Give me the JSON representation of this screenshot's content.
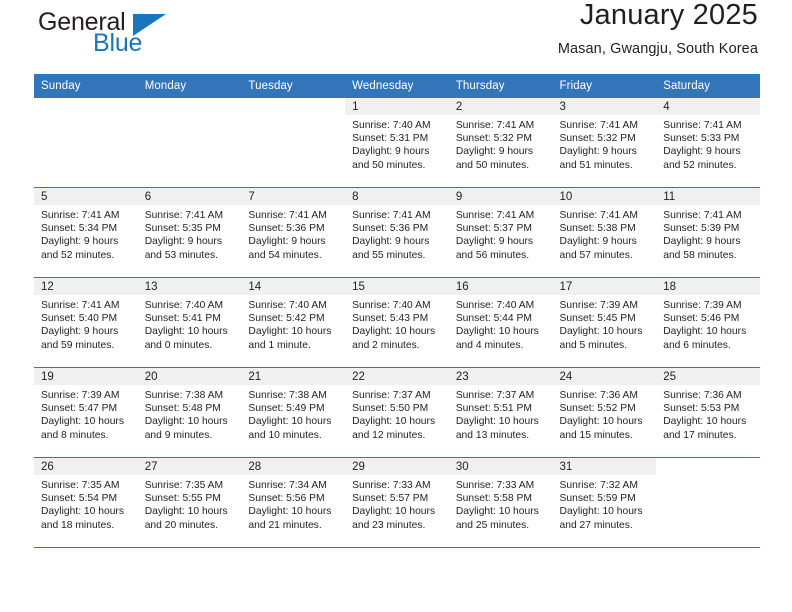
{
  "brand": {
    "name_part1": "General",
    "name_part2": "Blue"
  },
  "header": {
    "title": "January 2025",
    "subtitle": "Masan, Gwangju, South Korea"
  },
  "calendar": {
    "weekday_headers": [
      "Sunday",
      "Monday",
      "Tuesday",
      "Wednesday",
      "Thursday",
      "Friday",
      "Saturday"
    ],
    "colors": {
      "header_blue": "#3275b8",
      "daynum_band": "#f0f0f0",
      "brand_blue": "#1b75bb",
      "text": "#231f20"
    },
    "weeks": [
      [
        {
          "day": "",
          "sunrise": "",
          "sunset": "",
          "daylight_line1": "",
          "daylight_line2": "",
          "blank": true
        },
        {
          "day": "",
          "sunrise": "",
          "sunset": "",
          "daylight_line1": "",
          "daylight_line2": "",
          "blank": true
        },
        {
          "day": "",
          "sunrise": "",
          "sunset": "",
          "daylight_line1": "",
          "daylight_line2": "",
          "blank": true
        },
        {
          "day": "1",
          "sunrise": "Sunrise: 7:40 AM",
          "sunset": "Sunset: 5:31 PM",
          "daylight_line1": "Daylight: 9 hours",
          "daylight_line2": "and 50 minutes."
        },
        {
          "day": "2",
          "sunrise": "Sunrise: 7:41 AM",
          "sunset": "Sunset: 5:32 PM",
          "daylight_line1": "Daylight: 9 hours",
          "daylight_line2": "and 50 minutes."
        },
        {
          "day": "3",
          "sunrise": "Sunrise: 7:41 AM",
          "sunset": "Sunset: 5:32 PM",
          "daylight_line1": "Daylight: 9 hours",
          "daylight_line2": "and 51 minutes."
        },
        {
          "day": "4",
          "sunrise": "Sunrise: 7:41 AM",
          "sunset": "Sunset: 5:33 PM",
          "daylight_line1": "Daylight: 9 hours",
          "daylight_line2": "and 52 minutes."
        }
      ],
      [
        {
          "day": "5",
          "sunrise": "Sunrise: 7:41 AM",
          "sunset": "Sunset: 5:34 PM",
          "daylight_line1": "Daylight: 9 hours",
          "daylight_line2": "and 52 minutes."
        },
        {
          "day": "6",
          "sunrise": "Sunrise: 7:41 AM",
          "sunset": "Sunset: 5:35 PM",
          "daylight_line1": "Daylight: 9 hours",
          "daylight_line2": "and 53 minutes."
        },
        {
          "day": "7",
          "sunrise": "Sunrise: 7:41 AM",
          "sunset": "Sunset: 5:36 PM",
          "daylight_line1": "Daylight: 9 hours",
          "daylight_line2": "and 54 minutes."
        },
        {
          "day": "8",
          "sunrise": "Sunrise: 7:41 AM",
          "sunset": "Sunset: 5:36 PM",
          "daylight_line1": "Daylight: 9 hours",
          "daylight_line2": "and 55 minutes."
        },
        {
          "day": "9",
          "sunrise": "Sunrise: 7:41 AM",
          "sunset": "Sunset: 5:37 PM",
          "daylight_line1": "Daylight: 9 hours",
          "daylight_line2": "and 56 minutes."
        },
        {
          "day": "10",
          "sunrise": "Sunrise: 7:41 AM",
          "sunset": "Sunset: 5:38 PM",
          "daylight_line1": "Daylight: 9 hours",
          "daylight_line2": "and 57 minutes."
        },
        {
          "day": "11",
          "sunrise": "Sunrise: 7:41 AM",
          "sunset": "Sunset: 5:39 PM",
          "daylight_line1": "Daylight: 9 hours",
          "daylight_line2": "and 58 minutes."
        }
      ],
      [
        {
          "day": "12",
          "sunrise": "Sunrise: 7:41 AM",
          "sunset": "Sunset: 5:40 PM",
          "daylight_line1": "Daylight: 9 hours",
          "daylight_line2": "and 59 minutes."
        },
        {
          "day": "13",
          "sunrise": "Sunrise: 7:40 AM",
          "sunset": "Sunset: 5:41 PM",
          "daylight_line1": "Daylight: 10 hours",
          "daylight_line2": "and 0 minutes."
        },
        {
          "day": "14",
          "sunrise": "Sunrise: 7:40 AM",
          "sunset": "Sunset: 5:42 PM",
          "daylight_line1": "Daylight: 10 hours",
          "daylight_line2": "and 1 minute."
        },
        {
          "day": "15",
          "sunrise": "Sunrise: 7:40 AM",
          "sunset": "Sunset: 5:43 PM",
          "daylight_line1": "Daylight: 10 hours",
          "daylight_line2": "and 2 minutes."
        },
        {
          "day": "16",
          "sunrise": "Sunrise: 7:40 AM",
          "sunset": "Sunset: 5:44 PM",
          "daylight_line1": "Daylight: 10 hours",
          "daylight_line2": "and 4 minutes."
        },
        {
          "day": "17",
          "sunrise": "Sunrise: 7:39 AM",
          "sunset": "Sunset: 5:45 PM",
          "daylight_line1": "Daylight: 10 hours",
          "daylight_line2": "and 5 minutes."
        },
        {
          "day": "18",
          "sunrise": "Sunrise: 7:39 AM",
          "sunset": "Sunset: 5:46 PM",
          "daylight_line1": "Daylight: 10 hours",
          "daylight_line2": "and 6 minutes."
        }
      ],
      [
        {
          "day": "19",
          "sunrise": "Sunrise: 7:39 AM",
          "sunset": "Sunset: 5:47 PM",
          "daylight_line1": "Daylight: 10 hours",
          "daylight_line2": "and 8 minutes."
        },
        {
          "day": "20",
          "sunrise": "Sunrise: 7:38 AM",
          "sunset": "Sunset: 5:48 PM",
          "daylight_line1": "Daylight: 10 hours",
          "daylight_line2": "and 9 minutes."
        },
        {
          "day": "21",
          "sunrise": "Sunrise: 7:38 AM",
          "sunset": "Sunset: 5:49 PM",
          "daylight_line1": "Daylight: 10 hours",
          "daylight_line2": "and 10 minutes."
        },
        {
          "day": "22",
          "sunrise": "Sunrise: 7:37 AM",
          "sunset": "Sunset: 5:50 PM",
          "daylight_line1": "Daylight: 10 hours",
          "daylight_line2": "and 12 minutes."
        },
        {
          "day": "23",
          "sunrise": "Sunrise: 7:37 AM",
          "sunset": "Sunset: 5:51 PM",
          "daylight_line1": "Daylight: 10 hours",
          "daylight_line2": "and 13 minutes."
        },
        {
          "day": "24",
          "sunrise": "Sunrise: 7:36 AM",
          "sunset": "Sunset: 5:52 PM",
          "daylight_line1": "Daylight: 10 hours",
          "daylight_line2": "and 15 minutes."
        },
        {
          "day": "25",
          "sunrise": "Sunrise: 7:36 AM",
          "sunset": "Sunset: 5:53 PM",
          "daylight_line1": "Daylight: 10 hours",
          "daylight_line2": "and 17 minutes."
        }
      ],
      [
        {
          "day": "26",
          "sunrise": "Sunrise: 7:35 AM",
          "sunset": "Sunset: 5:54 PM",
          "daylight_line1": "Daylight: 10 hours",
          "daylight_line2": "and 18 minutes."
        },
        {
          "day": "27",
          "sunrise": "Sunrise: 7:35 AM",
          "sunset": "Sunset: 5:55 PM",
          "daylight_line1": "Daylight: 10 hours",
          "daylight_line2": "and 20 minutes."
        },
        {
          "day": "28",
          "sunrise": "Sunrise: 7:34 AM",
          "sunset": "Sunset: 5:56 PM",
          "daylight_line1": "Daylight: 10 hours",
          "daylight_line2": "and 21 minutes."
        },
        {
          "day": "29",
          "sunrise": "Sunrise: 7:33 AM",
          "sunset": "Sunset: 5:57 PM",
          "daylight_line1": "Daylight: 10 hours",
          "daylight_line2": "and 23 minutes."
        },
        {
          "day": "30",
          "sunrise": "Sunrise: 7:33 AM",
          "sunset": "Sunset: 5:58 PM",
          "daylight_line1": "Daylight: 10 hours",
          "daylight_line2": "and 25 minutes."
        },
        {
          "day": "31",
          "sunrise": "Sunrise: 7:32 AM",
          "sunset": "Sunset: 5:59 PM",
          "daylight_line1": "Daylight: 10 hours",
          "daylight_line2": "and 27 minutes."
        },
        {
          "day": "",
          "sunrise": "",
          "sunset": "",
          "daylight_line1": "",
          "daylight_line2": "",
          "blank": true
        }
      ]
    ]
  }
}
